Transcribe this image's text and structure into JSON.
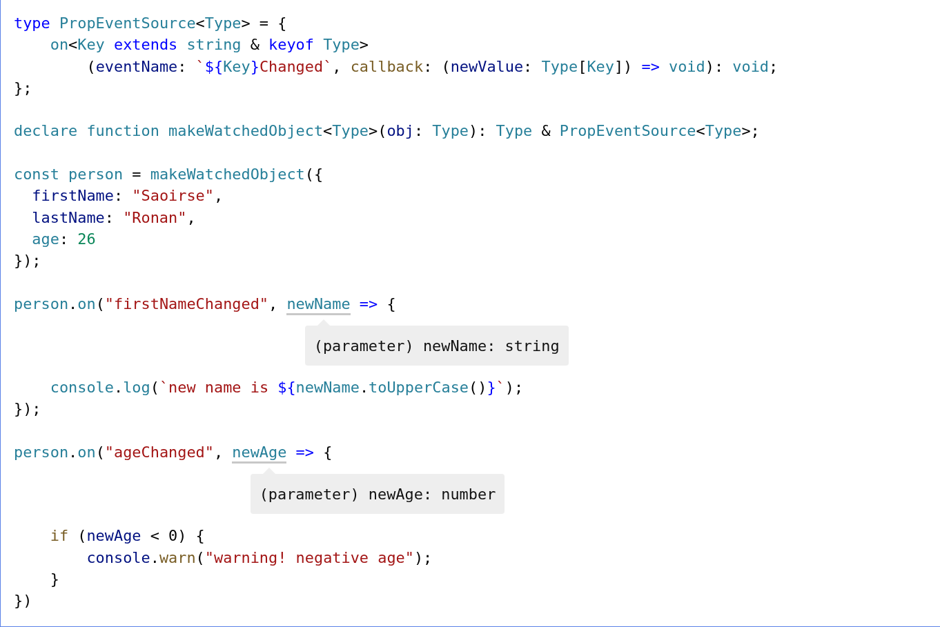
{
  "code_lines": [
    {
      "kind": "code",
      "tokens": [
        {
          "kind": "keyword",
          "text": "type "
        },
        {
          "kind": "type",
          "text": "PropEventSource"
        },
        {
          "kind": "plain",
          "text": "<"
        },
        {
          "kind": "type",
          "text": "Type"
        },
        {
          "kind": "plain",
          "text": "> = {"
        }
      ]
    },
    {
      "kind": "code",
      "tokens": [
        {
          "kind": "type",
          "text": "    on"
        },
        {
          "kind": "plain",
          "text": "<"
        },
        {
          "kind": "type",
          "text": "Key "
        },
        {
          "kind": "keyword",
          "text": "extends "
        },
        {
          "kind": "type",
          "text": "string"
        },
        {
          "kind": "plain",
          "text": " & "
        },
        {
          "kind": "keyword",
          "text": "keyof "
        },
        {
          "kind": "type",
          "text": "Type"
        },
        {
          "kind": "plain",
          "text": ">"
        }
      ]
    },
    {
      "kind": "code",
      "tokens": [
        {
          "kind": "plain",
          "text": "        ("
        },
        {
          "kind": "variable",
          "text": "eventName"
        },
        {
          "kind": "plain",
          "text": ": "
        },
        {
          "kind": "string",
          "text": "`"
        },
        {
          "kind": "keyword",
          "text": "${"
        },
        {
          "kind": "type",
          "text": "Key"
        },
        {
          "kind": "keyword",
          "text": "}"
        },
        {
          "kind": "string",
          "text": "Changed`"
        },
        {
          "kind": "plain",
          "text": ", "
        },
        {
          "kind": "function",
          "text": "callback"
        },
        {
          "kind": "plain",
          "text": ": ("
        },
        {
          "kind": "variable",
          "text": "newValue"
        },
        {
          "kind": "plain",
          "text": ": "
        },
        {
          "kind": "type",
          "text": "Type"
        },
        {
          "kind": "plain",
          "text": "["
        },
        {
          "kind": "type",
          "text": "Key"
        },
        {
          "kind": "plain",
          "text": "]) "
        },
        {
          "kind": "keyword",
          "text": "=> "
        },
        {
          "kind": "type",
          "text": "void"
        },
        {
          "kind": "plain",
          "text": "): "
        },
        {
          "kind": "type",
          "text": "void"
        },
        {
          "kind": "plain",
          "text": ";"
        }
      ]
    },
    {
      "kind": "code",
      "tokens": [
        {
          "kind": "plain",
          "text": "};"
        }
      ]
    },
    {
      "kind": "blank"
    },
    {
      "kind": "code",
      "tokens": [
        {
          "kind": "type",
          "text": "declare function makeWatchedObject"
        },
        {
          "kind": "plain",
          "text": "<"
        },
        {
          "kind": "type",
          "text": "Type"
        },
        {
          "kind": "plain",
          "text": ">("
        },
        {
          "kind": "variable",
          "text": "obj"
        },
        {
          "kind": "plain",
          "text": ": "
        },
        {
          "kind": "type",
          "text": "Type"
        },
        {
          "kind": "plain",
          "text": "): "
        },
        {
          "kind": "type",
          "text": "Type"
        },
        {
          "kind": "plain",
          "text": " & "
        },
        {
          "kind": "type",
          "text": "PropEventSource"
        },
        {
          "kind": "plain",
          "text": "<"
        },
        {
          "kind": "type",
          "text": "Type"
        },
        {
          "kind": "plain",
          "text": ">;"
        }
      ]
    },
    {
      "kind": "blank"
    },
    {
      "kind": "code",
      "tokens": [
        {
          "kind": "type",
          "text": "const person"
        },
        {
          "kind": "plain",
          "text": " = "
        },
        {
          "kind": "type",
          "text": "makeWatchedObject"
        },
        {
          "kind": "plain",
          "text": "({"
        }
      ]
    },
    {
      "kind": "code",
      "tokens": [
        {
          "kind": "variable",
          "text": "  firstName"
        },
        {
          "kind": "plain",
          "text": ": "
        },
        {
          "kind": "string",
          "text": "\"Saoirse\""
        },
        {
          "kind": "plain",
          "text": ","
        }
      ]
    },
    {
      "kind": "code",
      "tokens": [
        {
          "kind": "variable",
          "text": "  lastName"
        },
        {
          "kind": "plain",
          "text": ": "
        },
        {
          "kind": "string",
          "text": "\"Ronan\""
        },
        {
          "kind": "plain",
          "text": ","
        }
      ]
    },
    {
      "kind": "code",
      "tokens": [
        {
          "kind": "type",
          "text": "  age"
        },
        {
          "kind": "plain",
          "text": ": "
        },
        {
          "kind": "number",
          "text": "26"
        }
      ]
    },
    {
      "kind": "code",
      "tokens": [
        {
          "kind": "plain",
          "text": "});"
        }
      ]
    },
    {
      "kind": "blank"
    },
    {
      "kind": "code",
      "tokens": [
        {
          "kind": "type",
          "text": "person"
        },
        {
          "kind": "plain",
          "text": "."
        },
        {
          "kind": "type",
          "text": "on"
        },
        {
          "kind": "plain",
          "text": "("
        },
        {
          "kind": "string",
          "text": "\"firstNameChanged\""
        },
        {
          "kind": "plain",
          "text": ", "
        },
        {
          "kind": "hovered",
          "text": "newName"
        },
        {
          "kind": "keyword",
          "text": " =>"
        },
        {
          "kind": "plain",
          "text": " {"
        }
      ]
    },
    {
      "kind": "tooltip",
      "text": "(parameter) newName: string"
    },
    {
      "kind": "code",
      "tokens": [
        {
          "kind": "type",
          "text": "    console"
        },
        {
          "kind": "plain",
          "text": "."
        },
        {
          "kind": "type",
          "text": "log"
        },
        {
          "kind": "plain",
          "text": "("
        },
        {
          "kind": "string",
          "text": "`new name is "
        },
        {
          "kind": "keyword",
          "text": "${"
        },
        {
          "kind": "type",
          "text": "newName"
        },
        {
          "kind": "plain",
          "text": "."
        },
        {
          "kind": "type",
          "text": "toUpperCase"
        },
        {
          "kind": "plain",
          "text": "()"
        },
        {
          "kind": "keyword",
          "text": "}"
        },
        {
          "kind": "string",
          "text": "`"
        },
        {
          "kind": "plain",
          "text": ");"
        }
      ]
    },
    {
      "kind": "code",
      "tokens": [
        {
          "kind": "plain",
          "text": "});"
        }
      ]
    },
    {
      "kind": "blank"
    },
    {
      "kind": "code",
      "tokens": [
        {
          "kind": "type",
          "text": "person"
        },
        {
          "kind": "plain",
          "text": "."
        },
        {
          "kind": "type",
          "text": "on"
        },
        {
          "kind": "plain",
          "text": "("
        },
        {
          "kind": "string",
          "text": "\"ageChanged\""
        },
        {
          "kind": "plain",
          "text": ", "
        },
        {
          "kind": "hovered",
          "text": "newAge"
        },
        {
          "kind": "keyword",
          "text": " =>"
        },
        {
          "kind": "plain",
          "text": " {"
        }
      ]
    },
    {
      "kind": "tooltip",
      "text": "(parameter) newAge: number"
    },
    {
      "kind": "code",
      "tokens": [
        {
          "kind": "function",
          "text": "    if"
        },
        {
          "kind": "plain",
          "text": " ("
        },
        {
          "kind": "variable",
          "text": "newAge"
        },
        {
          "kind": "plain",
          "text": " < 0) {"
        }
      ]
    },
    {
      "kind": "code",
      "tokens": [
        {
          "kind": "variable",
          "text": "        console"
        },
        {
          "kind": "plain",
          "text": "."
        },
        {
          "kind": "function",
          "text": "warn"
        },
        {
          "kind": "plain",
          "text": "("
        },
        {
          "kind": "string",
          "text": "\"warning! negative age\""
        },
        {
          "kind": "plain",
          "text": ");"
        }
      ]
    },
    {
      "kind": "code",
      "tokens": [
        {
          "kind": "plain",
          "text": "    }"
        }
      ]
    },
    {
      "kind": "code",
      "tokens": [
        {
          "kind": "plain",
          "text": "})"
        }
      ]
    }
  ]
}
